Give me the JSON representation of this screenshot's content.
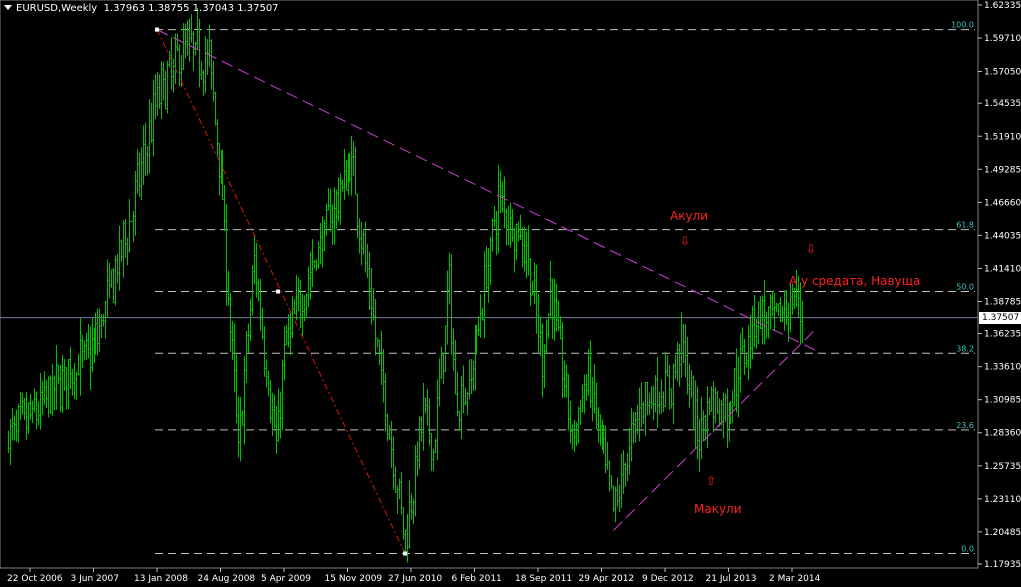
{
  "window": {
    "symbol_title": "EURUSD,Weekly",
    "ohlc": "1.37963 1.38755 1.37043 1.37507"
  },
  "annotations": {
    "sell_label": "Акули",
    "middle_label": "А у средата, Навуща",
    "buy_label": "Макули",
    "down_arrow": "⇩",
    "up_arrow": "⇧"
  },
  "colors": {
    "background": "#000000",
    "bars": "#00c000",
    "grid_fib": "#c0c0c0",
    "fib_labels": "#40c0c0",
    "trendlines": "#d040d0",
    "fib_base_line": "#d02000",
    "annotation_text": "#ff2020",
    "current_price_line": "#7080a0"
  },
  "chart_data": {
    "type": "ohlc",
    "symbol": "EURUSD",
    "timeframe": "Weekly",
    "current_price": "1.37507",
    "ylim": [
      1.176,
      1.6265
    ],
    "y_ticks": [
      "1.62335",
      "1.59710",
      "1.57050",
      "1.54535",
      "1.51910",
      "1.49285",
      "1.46660",
      "1.44035",
      "1.41410",
      "1.38785",
      "1.36235",
      "1.33610",
      "1.30985",
      "1.28360",
      "1.25735",
      "1.23110",
      "1.20485",
      "1.17935"
    ],
    "x_ticks": [
      "22 Oct 2006",
      "3 Jun 2007",
      "13 Jan 2008",
      "24 Aug 2008",
      "5 Apr 2009",
      "15 Nov 2009",
      "27 Jun 2010",
      "6 Feb 2011",
      "18 Sep 2011",
      "29 Apr 2012",
      "9 Dec 2012",
      "21 Jul 2013",
      "2 Mar 2014"
    ],
    "fibonacci": {
      "high": 1.6038,
      "low": 1.1877,
      "levels": [
        {
          "label": "100.0",
          "price": 1.6038
        },
        {
          "label": "61.8",
          "price": 1.4449
        },
        {
          "label": "50.0",
          "price": 1.3958
        },
        {
          "label": "38.2",
          "price": 1.3467
        },
        {
          "label": "23.6",
          "price": 1.2859
        },
        {
          "label": "0.0",
          "price": 1.1877
        }
      ]
    },
    "trendlines": [
      {
        "name": "resistance",
        "from": {
          "date": "2008-01-13",
          "price": 1.6038
        },
        "to": {
          "date": "2014-06-15",
          "price": 1.3467
        }
      },
      {
        "name": "support",
        "from": {
          "date": "2012-06-10",
          "price": 1.206
        },
        "to": {
          "date": "2014-05-25",
          "price": 1.366
        }
      }
    ],
    "fib_base_line": {
      "from": {
        "date": "2008-01-13",
        "price": 1.6038
      },
      "to": {
        "date": "2010-06-06",
        "price": 1.1877
      }
    },
    "price_path": [
      {
        "date": "2006-08-06",
        "price": 1.28
      },
      {
        "date": "2006-11-12",
        "price": 1.3
      },
      {
        "date": "2007-02-25",
        "price": 1.33
      },
      {
        "date": "2007-06-03",
        "price": 1.35
      },
      {
        "date": "2007-10-07",
        "price": 1.45
      },
      {
        "date": "2008-01-13",
        "price": 1.55
      },
      {
        "date": "2008-04-20",
        "price": 1.59
      },
      {
        "date": "2008-07-13",
        "price": 1.58
      },
      {
        "date": "2008-08-24",
        "price": 1.49
      },
      {
        "date": "2008-10-26",
        "price": 1.27
      },
      {
        "date": "2008-12-21",
        "price": 1.42
      },
      {
        "date": "2009-03-08",
        "price": 1.27
      },
      {
        "date": "2009-04-05",
        "price": 1.35
      },
      {
        "date": "2009-08-02",
        "price": 1.43
      },
      {
        "date": "2009-11-29",
        "price": 1.5
      },
      {
        "date": "2010-02-21",
        "price": 1.36
      },
      {
        "date": "2010-06-06",
        "price": 1.2
      },
      {
        "date": "2010-08-08",
        "price": 1.3
      },
      {
        "date": "2010-09-12",
        "price": 1.27
      },
      {
        "date": "2010-11-07",
        "price": 1.4
      },
      {
        "date": "2010-11-28",
        "price": 1.31
      },
      {
        "date": "2011-01-16",
        "price": 1.32
      },
      {
        "date": "2011-05-01",
        "price": 1.47
      },
      {
        "date": "2011-08-07",
        "price": 1.43
      },
      {
        "date": "2011-10-02",
        "price": 1.34
      },
      {
        "date": "2011-10-30",
        "price": 1.4
      },
      {
        "date": "2012-01-15",
        "price": 1.28
      },
      {
        "date": "2012-03-11",
        "price": 1.33
      },
      {
        "date": "2012-06-10",
        "price": 1.22
      },
      {
        "date": "2012-09-16",
        "price": 1.31
      },
      {
        "date": "2012-12-30",
        "price": 1.32
      },
      {
        "date": "2013-02-03",
        "price": 1.36
      },
      {
        "date": "2013-03-31",
        "price": 1.28
      },
      {
        "date": "2013-05-12",
        "price": 1.31
      },
      {
        "date": "2013-07-14",
        "price": 1.3
      },
      {
        "date": "2013-10-27",
        "price": 1.38
      },
      {
        "date": "2013-12-22",
        "price": 1.37
      },
      {
        "date": "2014-03-16",
        "price": 1.39
      },
      {
        "date": "2014-04-06",
        "price": 1.375
      }
    ]
  }
}
